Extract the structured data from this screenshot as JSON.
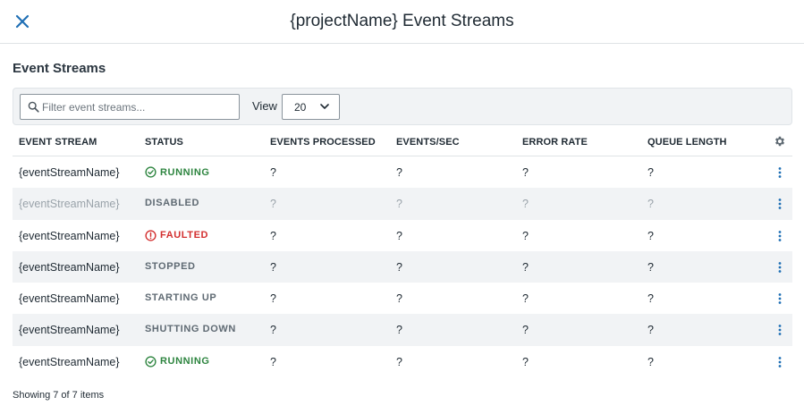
{
  "header": {
    "title": "{projectName} Event Streams"
  },
  "section": {
    "title": "Event Streams"
  },
  "toolbar": {
    "search_placeholder": "Filter event streams...",
    "view_label": "View",
    "view_value": "20"
  },
  "table": {
    "columns": [
      "EVENT STREAM",
      "STATUS",
      "EVENTS PROCESSED",
      "EVENTS/SEC",
      "ERROR RATE",
      "QUEUE LENGTH"
    ],
    "rows": [
      {
        "name": "{eventStreamName}",
        "status": "RUNNING",
        "events_processed": "?",
        "events_sec": "?",
        "error_rate": "?",
        "queue_length": "?"
      },
      {
        "name": "{eventStreamName}",
        "status": "DISABLED",
        "events_processed": "?",
        "events_sec": "?",
        "error_rate": "?",
        "queue_length": "?"
      },
      {
        "name": "{eventStreamName}",
        "status": "FAULTED",
        "events_processed": "?",
        "events_sec": "?",
        "error_rate": "?",
        "queue_length": "?"
      },
      {
        "name": "{eventStreamName}",
        "status": "STOPPED",
        "events_processed": "?",
        "events_sec": "?",
        "error_rate": "?",
        "queue_length": "?"
      },
      {
        "name": "{eventStreamName}",
        "status": "STARTING UP",
        "events_processed": "?",
        "events_sec": "?",
        "error_rate": "?",
        "queue_length": "?"
      },
      {
        "name": "{eventStreamName}",
        "status": "SHUTTING DOWN",
        "events_processed": "?",
        "events_sec": "?",
        "error_rate": "?",
        "queue_length": "?"
      },
      {
        "name": "{eventStreamName}",
        "status": "RUNNING",
        "events_processed": "?",
        "events_sec": "?",
        "error_rate": "?",
        "queue_length": "?"
      }
    ]
  },
  "footer": {
    "text": "Showing 7 of 7 items"
  },
  "icons": {
    "close": "close-icon",
    "search": "search-icon",
    "chevron": "chevron-down-icon",
    "settings": "gear-icon",
    "row_menu": "kebab-menu-icon",
    "running": "check-circle-icon",
    "faulted": "alert-circle-icon"
  },
  "colors": {
    "accent": "#1f6fb5",
    "running": "#2e8540",
    "faulted": "#d32f2f",
    "neutral_status": "#5f6a73",
    "disabled_text": "#9aa3aa",
    "stripe": "#f1f3f5"
  }
}
